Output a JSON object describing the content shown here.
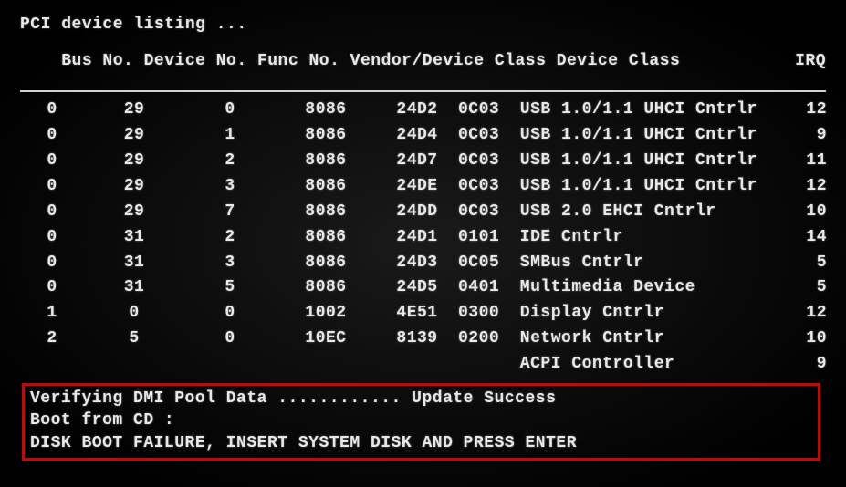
{
  "header": {
    "title": "PCI device listing ...",
    "columns_line": "Bus No. Device No. Func No. Vendor/Device Class Device Class",
    "irq_label": "IRQ"
  },
  "rows": [
    {
      "bus": "0",
      "device": "29",
      "func": "0",
      "vendor": "8086",
      "devclass": "24D2",
      "class_code": "0C03",
      "desc": "USB 1.0/1.1 UHCI Cntrlr",
      "irq": "12"
    },
    {
      "bus": "0",
      "device": "29",
      "func": "1",
      "vendor": "8086",
      "devclass": "24D4",
      "class_code": "0C03",
      "desc": "USB 1.0/1.1 UHCI Cntrlr",
      "irq": "9"
    },
    {
      "bus": "0",
      "device": "29",
      "func": "2",
      "vendor": "8086",
      "devclass": "24D7",
      "class_code": "0C03",
      "desc": "USB 1.0/1.1 UHCI Cntrlr",
      "irq": "11"
    },
    {
      "bus": "0",
      "device": "29",
      "func": "3",
      "vendor": "8086",
      "devclass": "24DE",
      "class_code": "0C03",
      "desc": "USB 1.0/1.1 UHCI Cntrlr",
      "irq": "12"
    },
    {
      "bus": "0",
      "device": "29",
      "func": "7",
      "vendor": "8086",
      "devclass": "24DD",
      "class_code": "0C03",
      "desc": "USB 2.0 EHCI Cntrlr",
      "irq": "10"
    },
    {
      "bus": "0",
      "device": "31",
      "func": "2",
      "vendor": "8086",
      "devclass": "24D1",
      "class_code": "0101",
      "desc": "IDE Cntrlr",
      "irq": "14"
    },
    {
      "bus": "0",
      "device": "31",
      "func": "3",
      "vendor": "8086",
      "devclass": "24D3",
      "class_code": "0C05",
      "desc": "SMBus Cntrlr",
      "irq": "5"
    },
    {
      "bus": "0",
      "device": "31",
      "func": "5",
      "vendor": "8086",
      "devclass": "24D5",
      "class_code": "0401",
      "desc": "Multimedia Device",
      "irq": "5"
    },
    {
      "bus": "1",
      "device": "0",
      "func": "0",
      "vendor": "1002",
      "devclass": "4E51",
      "class_code": "0300",
      "desc": "Display Cntrlr",
      "irq": "12"
    },
    {
      "bus": "2",
      "device": "5",
      "func": "0",
      "vendor": "10EC",
      "devclass": "8139",
      "class_code": "0200",
      "desc": "Network Cntrlr",
      "irq": "10"
    }
  ],
  "acpi_row": {
    "desc": "ACPI Controller",
    "irq": "9"
  },
  "footer": {
    "dmi": "Verifying DMI Pool Data ............ Update Success",
    "boot": "Boot from CD :",
    "fail": "DISK BOOT FAILURE, INSERT SYSTEM DISK AND PRESS ENTER"
  }
}
